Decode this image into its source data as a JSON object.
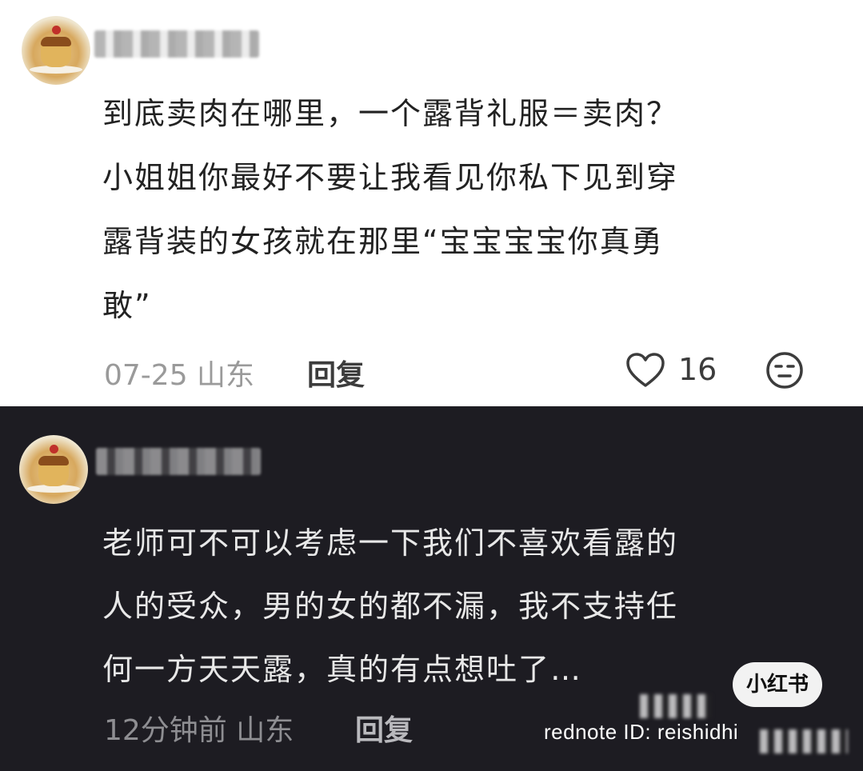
{
  "comments": [
    {
      "theme": "light",
      "text": "到底卖肉在哪里，一个露背礼服＝卖肉？\n小姐姐你最好不要让我看见你私下见到穿\n露背装的女孩就在那里“宝宝宝宝你真勇\n敢”",
      "date_location": "07-25 山东",
      "reply_label": "回复",
      "likes": "16",
      "icons": {
        "like": "heart-outline-icon",
        "emoji": "emoji-face-icon"
      }
    },
    {
      "theme": "dark",
      "text": "老师可不可以考虑一下我们不喜欢看露的\n人的受众，男的女的都不漏，我不支持任\n何一方天天露，真的有点想吐了…",
      "date_location": "12分钟前 山东",
      "reply_label": "回复"
    }
  ],
  "watermark": {
    "pill_label": "小红书",
    "id_text": "rednote ID: reishidhi"
  },
  "colors": {
    "light_bg": "#ffffff",
    "dark_bg": "#1d1c22"
  }
}
